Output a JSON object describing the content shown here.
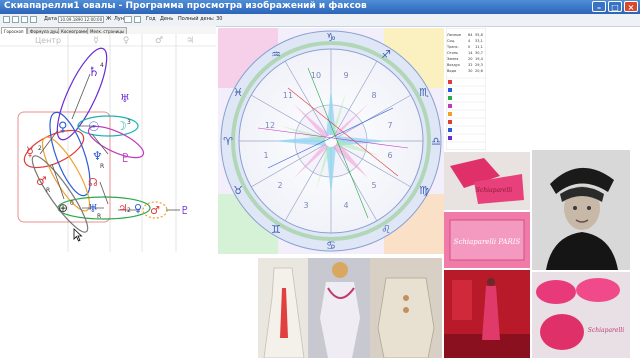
{
  "window": {
    "title": "Скиапарелли1 овалы - Программа просмотра изображений и факсов",
    "buttons": [
      "–",
      "□",
      "×"
    ]
  },
  "toolbar": {
    "date_label": "Дата",
    "date_value": "10.09.1890 12:00:00",
    "date_suffix": "Ж",
    "time_label": "Луна",
    "options": [
      "Год",
      "День",
      "Полный день: 30"
    ]
  },
  "tabs": [
    "Гороскоп",
    "Формула души",
    "Космограмма",
    "Мелк. страницы"
  ],
  "diagram": {
    "header": [
      "Центр",
      "☿",
      "♀",
      "♂",
      "♃"
    ],
    "colors": {
      "red": "#e03a3a",
      "green": "#2aa84a",
      "blue": "#2b5bd6",
      "purple": "#7a2bd6",
      "teal": "#19b3b3",
      "magenta": "#c03ac0",
      "orange": "#f0a02a",
      "gray": "#777777"
    },
    "glyphs": [
      {
        "id": "saturn",
        "symbol": "♄",
        "sup": "4"
      },
      {
        "id": "uranus",
        "symbol": "♅"
      },
      {
        "id": "venus",
        "symbol": "♀"
      },
      {
        "id": "sun",
        "symbol": "☉"
      },
      {
        "id": "moon",
        "symbol": "☽",
        "sup": "3"
      },
      {
        "id": "mercury",
        "symbol": "☿",
        "sup": "2"
      },
      {
        "id": "neptune",
        "symbol": "♆",
        "sub": "R"
      },
      {
        "id": "pluto",
        "symbol": "♇"
      },
      {
        "id": "mars",
        "symbol": "♂",
        "sub": "R"
      },
      {
        "id": "node",
        "symbol": "☊"
      },
      {
        "id": "earth",
        "symbol": "⊕",
        "sup": "0"
      },
      {
        "id": "uranus2",
        "symbol": "♅",
        "sub": "R"
      },
      {
        "id": "jupiter",
        "symbol": "♃",
        "sup": "2"
      },
      {
        "id": "venus2",
        "symbol": "♀"
      },
      {
        "id": "mars2",
        "symbol": "♂"
      },
      {
        "id": "pluto2",
        "symbol": "♇"
      }
    ]
  },
  "zodiac": [
    "♈",
    "♉",
    "♊",
    "♋",
    "♌",
    "♍",
    "♎",
    "♏",
    "♐",
    "♑",
    "♒",
    "♓"
  ],
  "houses": [
    "1",
    "2",
    "3",
    "4",
    "5",
    "6",
    "7",
    "8",
    "9",
    "10",
    "11",
    "12"
  ],
  "side_table": {
    "rows": [
      [
        "Личные",
        "64",
        "55,8"
      ],
      [
        "Соц.",
        "4",
        "33,1"
      ],
      [
        "Транс.",
        "0",
        "11,1"
      ],
      [
        "Огонь",
        "14",
        "30,7"
      ],
      [
        "Земля",
        "20",
        "19,4"
      ],
      [
        "Воздух",
        "32",
        "29,3"
      ],
      [
        "Вода",
        "30",
        "20,6"
      ]
    ]
  },
  "photos": [
    {
      "id": "pink-gloves",
      "label": "Schiaparelli"
    },
    {
      "id": "portrait",
      "label": ""
    },
    {
      "id": "pink-box",
      "label": "Schiaparelli PARIS"
    },
    {
      "id": "dresses",
      "label": ""
    },
    {
      "id": "red-room",
      "label": ""
    },
    {
      "id": "pink-hats",
      "label": "Schiaparelli"
    }
  ]
}
